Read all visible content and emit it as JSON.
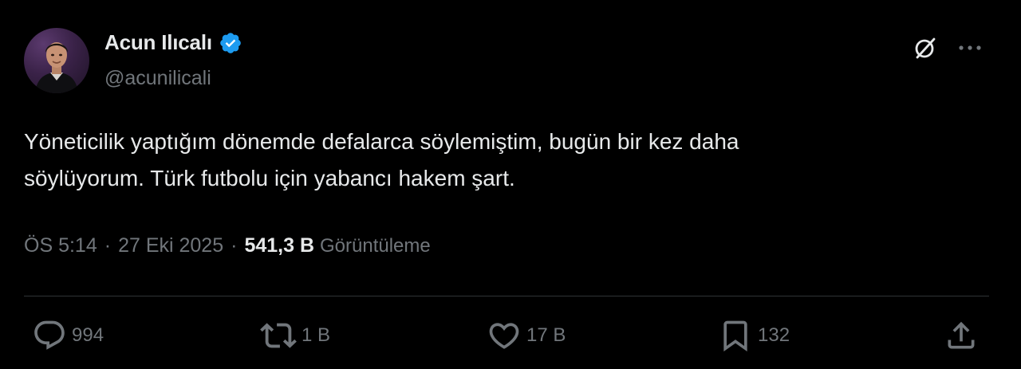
{
  "user": {
    "display_name": "Acun Ilıcalı",
    "handle": "@acunilicali",
    "verified": true
  },
  "tweet": {
    "text_line1": "Yöneticilik yaptığım dönemde defalarca söylemiştim, bugün bir kez daha",
    "text_line2": "söylüyorum. Türk futbolu için yabancı hakem şart."
  },
  "meta": {
    "time": "ÖS 5:14",
    "separator": "·",
    "date": "27 Eki 2025",
    "views_count": "541,3 B",
    "views_label": "Görüntüleme"
  },
  "actions": {
    "replies": "994",
    "reposts": "1 B",
    "likes": "17 B",
    "bookmarks": "132"
  },
  "icons": {
    "more": "more-icon",
    "grok": "grok-icon",
    "reply": "reply-icon",
    "repost": "repost-icon",
    "like": "heart-icon",
    "bookmark": "bookmark-icon",
    "share": "share-icon",
    "verified": "verified-badge-icon"
  },
  "colors": {
    "background": "#000000",
    "text_primary": "#e7e9ea",
    "text_secondary": "#71767b",
    "verified_blue": "#1d9bf0",
    "divider": "#2f3336"
  }
}
